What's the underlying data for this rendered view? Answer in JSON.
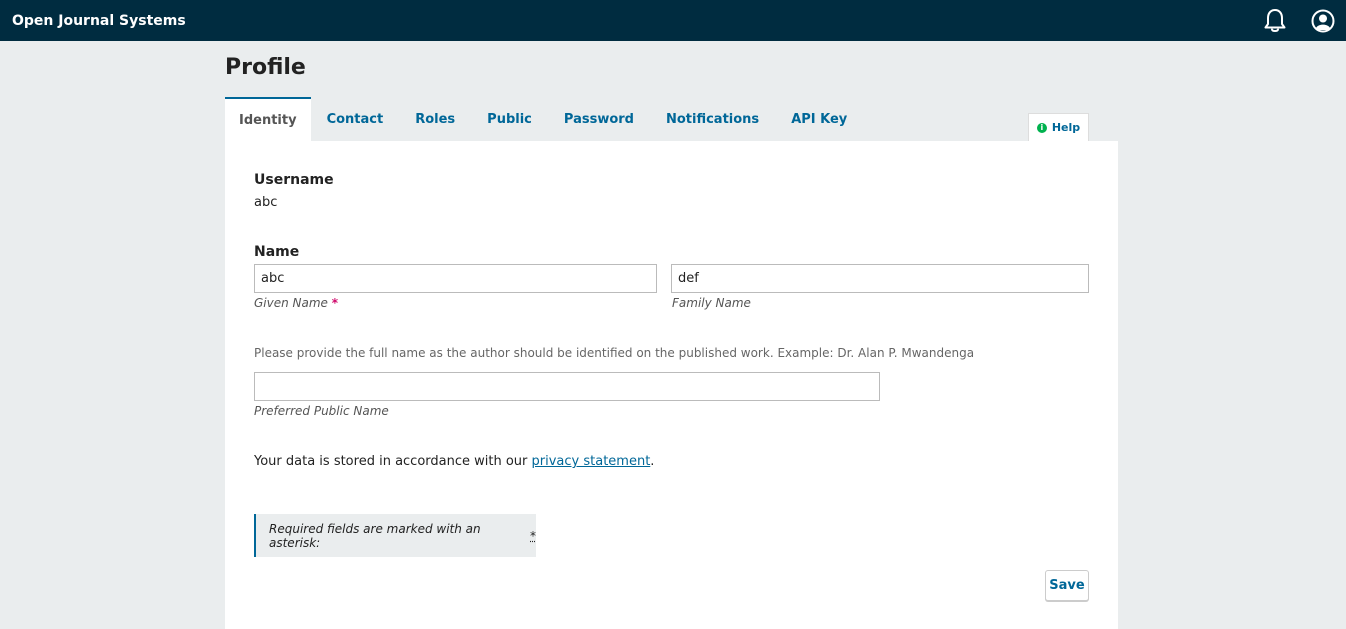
{
  "app": {
    "title": "Open Journal Systems"
  },
  "header": {
    "notifications_icon": "bell-icon",
    "user_icon": "user-circle-icon"
  },
  "page": {
    "title": "Profile"
  },
  "tabs": [
    {
      "label": "Identity",
      "active": true
    },
    {
      "label": "Contact"
    },
    {
      "label": "Roles"
    },
    {
      "label": "Public"
    },
    {
      "label": "Password"
    },
    {
      "label": "Notifications"
    },
    {
      "label": "API Key"
    }
  ],
  "help": {
    "label": "Help",
    "icon": "info-icon"
  },
  "form": {
    "username_label": "Username",
    "username_value": "abc",
    "name_label": "Name",
    "given_name_value": "abc",
    "given_name_label": "Given Name",
    "required_marker": "*",
    "family_name_value": "def",
    "family_name_label": "Family Name",
    "preferred_description": "Please provide the full name as the author should be identified on the published work. Example: Dr. Alan P. Mwandenga",
    "preferred_name_value": "",
    "preferred_name_label": "Preferred Public Name",
    "privacy_prefix": "Your data is stored in accordance with our ",
    "privacy_link": "privacy statement",
    "privacy_suffix": ".",
    "required_notice": "Required fields are marked with an asterisk:",
    "required_notice_marker": "*",
    "save_label": "Save"
  },
  "colors": {
    "header_bg": "#002c40",
    "accent": "#006798",
    "required": "#d00a6c",
    "help_dot": "#00b24e"
  }
}
